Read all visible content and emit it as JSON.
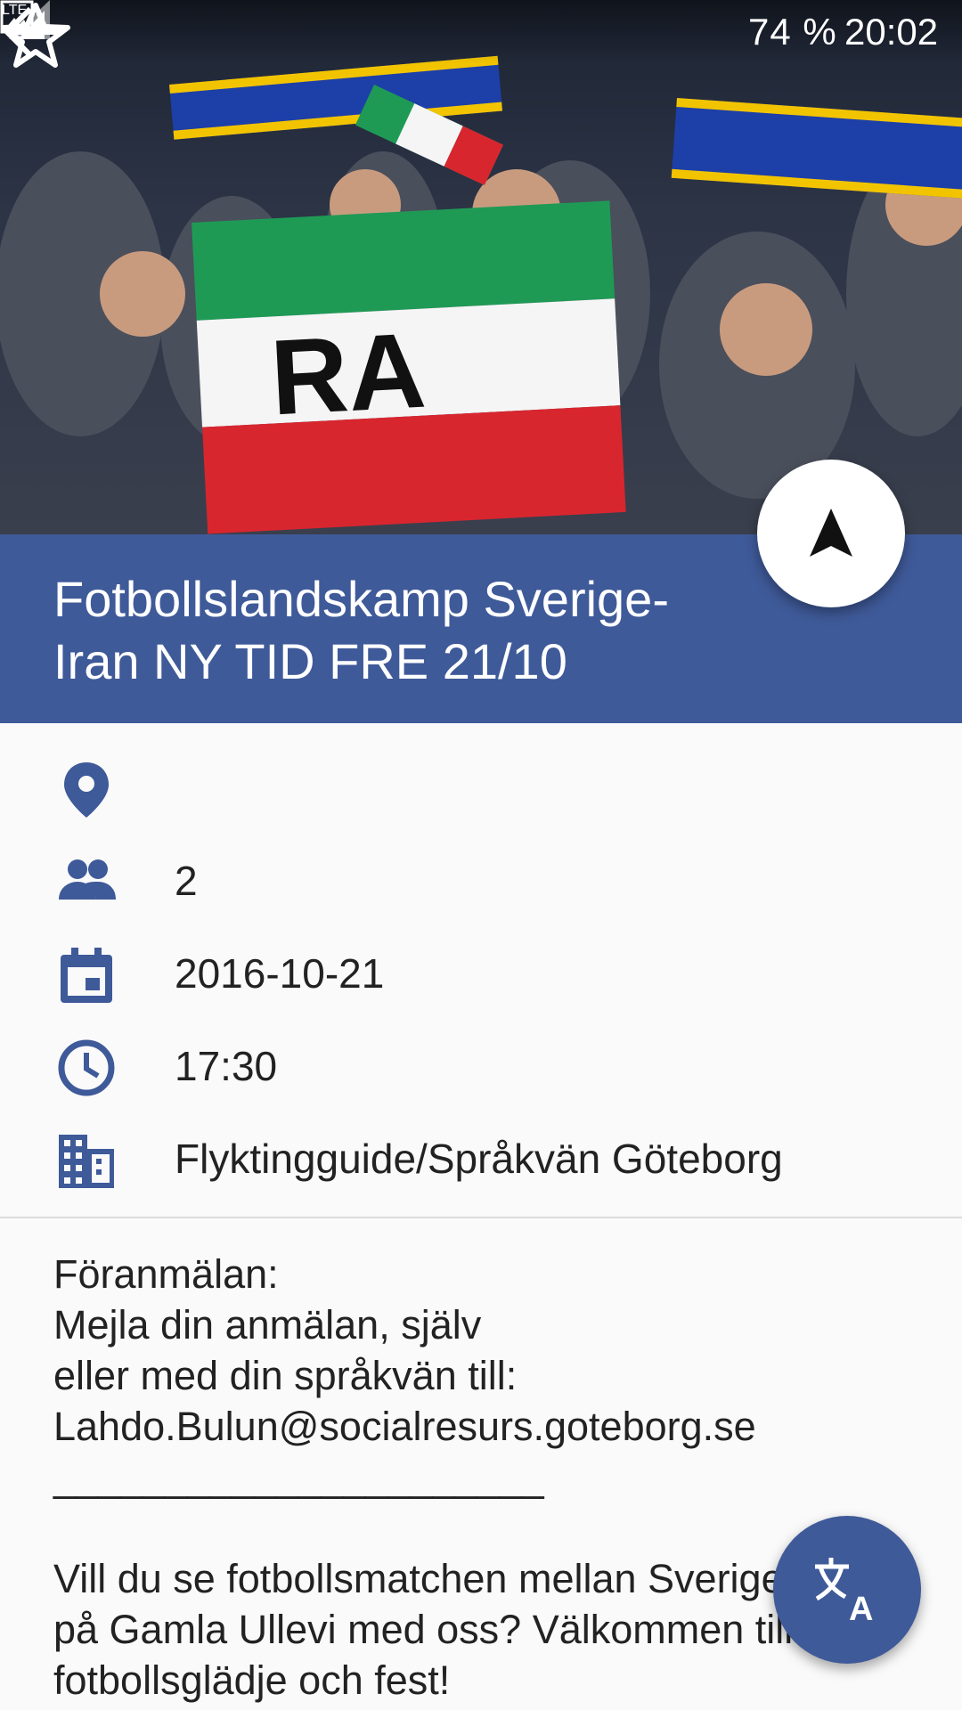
{
  "status_bar": {
    "battery": "74 %",
    "time": "20:02",
    "network": "LTE"
  },
  "event": {
    "title": "Fotbollslandskamp Sverige-Iran NY TID FRE 21/10",
    "location": "",
    "participants": "2",
    "date": "2016-10-21",
    "time": "17:30",
    "organizer": "Flyktingguide/Språkvän Göteborg"
  },
  "description": "Föranmälan:\nMejla din anmälan, själv\neller med din språkvän till:\nLahdo.Bulun@socialresurs.goteborg.se\n______________________\n\nVill du se fotbollsmatchen mellan Sverige-Iran på Gamla Ullevi med oss? Välkommen till en fotbollsglädje och fest!",
  "icons": {
    "back": "arrow-back-icon",
    "favorite": "star-outline-icon",
    "navigate": "navigation-arrow-icon",
    "location": "location-pin-icon",
    "participants": "people-icon",
    "date": "calendar-icon",
    "time": "clock-icon",
    "organizer": "building-icon",
    "translate": "translate-icon"
  },
  "colors": {
    "primary": "#3f5a99",
    "background": "#fafafa",
    "text": "#222222"
  }
}
